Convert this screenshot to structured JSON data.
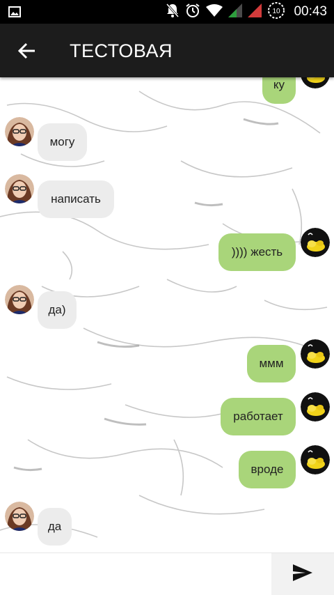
{
  "status_bar": {
    "time": "00:43",
    "battery_level": "10",
    "icons": [
      "image-icon",
      "bell-off-icon",
      "alarm-icon",
      "wifi-icon",
      "signal-icon",
      "signal-empty-icon",
      "battery-icon"
    ]
  },
  "app_bar": {
    "title": "ТЕСТОВАЯ",
    "back_icon": "arrow-left-icon"
  },
  "messages": [
    {
      "side": "out",
      "text": "ку"
    },
    {
      "side": "in",
      "text": "могу"
    },
    {
      "side": "in",
      "text": "написать"
    },
    {
      "side": "out",
      "text": ")))) жесть"
    },
    {
      "side": "in",
      "text": "да)"
    },
    {
      "side": "out",
      "text": "ммм"
    },
    {
      "side": "out",
      "text": "работает"
    },
    {
      "side": "out",
      "text": "вроде"
    },
    {
      "side": "in",
      "text": "да"
    }
  ],
  "composer": {
    "placeholder": "",
    "send_icon": "send-icon"
  },
  "colors": {
    "outgoing_bubble": "#a9d57a",
    "incoming_bubble": "#ececec",
    "app_bar": "#1c1c1c"
  }
}
